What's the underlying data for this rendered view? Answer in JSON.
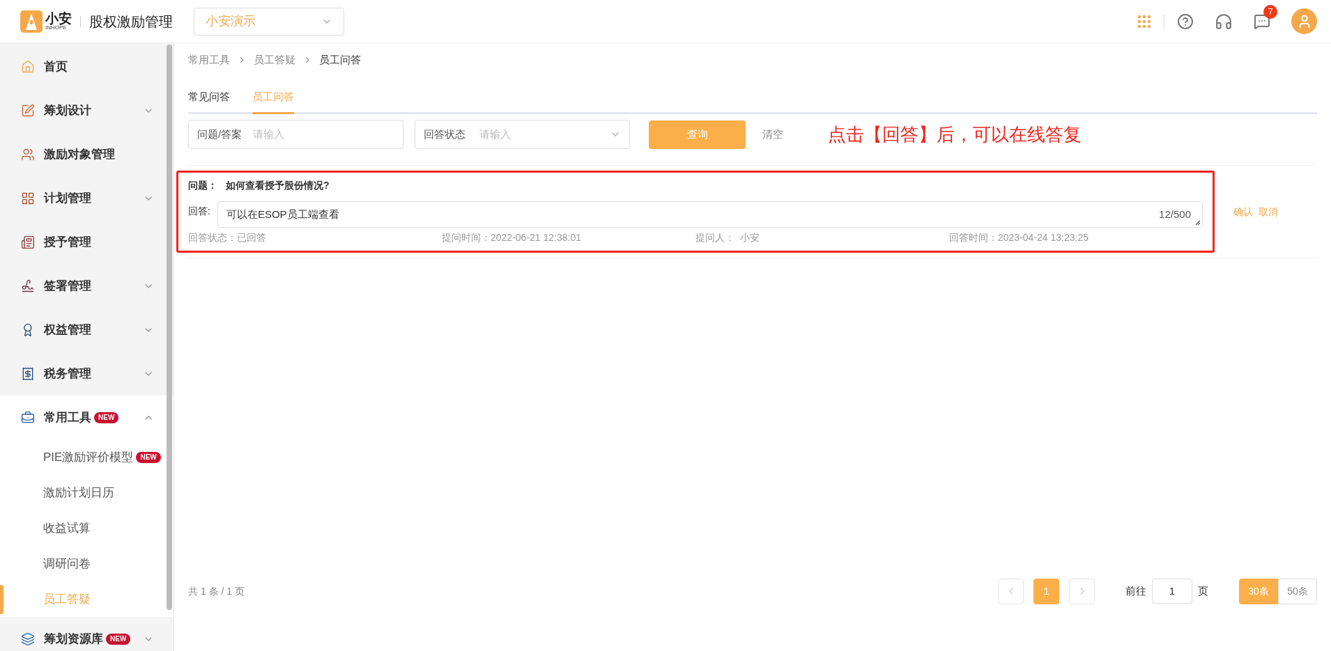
{
  "header": {
    "logo_text": "小安",
    "logo_sub": "INHOPE",
    "app_title": "股权激励管理",
    "company_select": {
      "value": "小安演示"
    },
    "notification_count": "7"
  },
  "sidebar": {
    "items": [
      {
        "kind": "link",
        "label": "首页",
        "selected": false
      },
      {
        "kind": "group",
        "label": "筹划设计",
        "expanded": false
      },
      {
        "kind": "link",
        "label": "激励对象管理",
        "selected": false
      },
      {
        "kind": "group",
        "label": "计划管理",
        "expanded": false
      },
      {
        "kind": "link",
        "label": "授予管理",
        "selected": false
      },
      {
        "kind": "group",
        "label": "签署管理",
        "expanded": false
      },
      {
        "kind": "group",
        "label": "权益管理",
        "expanded": false
      },
      {
        "kind": "group",
        "label": "税务管理",
        "expanded": false
      },
      {
        "kind": "group",
        "label": "常用工具",
        "badge": "NEW",
        "expanded": true,
        "children": [
          {
            "label": "PIE激励评价模型",
            "badge": "NEW",
            "selected": false
          },
          {
            "label": "激励计划日历",
            "selected": false
          },
          {
            "label": "收益试算",
            "selected": false
          },
          {
            "label": "调研问卷",
            "selected": false
          },
          {
            "label": "员工答疑",
            "selected": true
          }
        ]
      },
      {
        "kind": "group",
        "label": "筹划资源库",
        "badge": "NEW",
        "expanded": false
      }
    ]
  },
  "breadcrumb": [
    "常用工具",
    "员工答疑",
    "员工问答"
  ],
  "tabs": [
    {
      "label": "常见问答",
      "selected": false
    },
    {
      "label": "员工问答",
      "selected": true
    }
  ],
  "filters": {
    "question_field": {
      "label": "问题/答案",
      "placeholder": "请输入"
    },
    "status_select": {
      "label": "回答状态",
      "placeholder": "请输入"
    },
    "search_button": "查询",
    "clear_button": "清空"
  },
  "annotation": "点击【回答】后，可以在线答复",
  "questions": [
    {
      "question_label": "问题：",
      "question": "如何查看授予股份情况?",
      "answer_label": "回答:",
      "answer": "可以在ESOP员工端查看",
      "char_count": "12/500",
      "highlighted": true,
      "meta": [
        "回答状态：已回答",
        "提问时间：2022-06-21 12:38:01",
        "提问人：  小安",
        "回答时间：2023-04-24 13:23:25"
      ],
      "actions": [
        "确认",
        "取消"
      ]
    }
  ],
  "footer": {
    "summary": "共 1 条 / 1 页",
    "pages": [
      {
        "label": "1",
        "selected": true
      }
    ],
    "goto_label": "前往",
    "goto_value": "1",
    "goto_suffix": "页",
    "page_sizes": [
      {
        "label": "30条",
        "selected": true
      },
      {
        "label": "50条",
        "selected": false
      }
    ]
  }
}
